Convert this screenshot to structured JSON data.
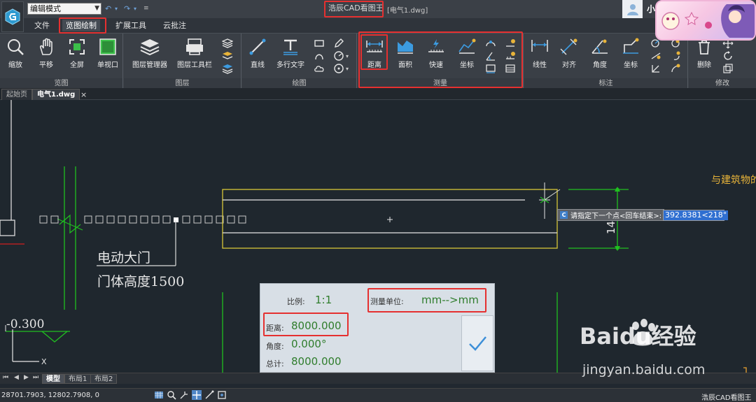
{
  "title_bar": {
    "mode": "编辑模式",
    "app_name": "浩辰CAD看图王",
    "file_name": "[电气1.dwg]",
    "user_name": "小可"
  },
  "menu": {
    "tabs": [
      "文件",
      "览图绘制",
      "扩展工具",
      "云批注"
    ],
    "active": "览图绘制"
  },
  "ribbon": {
    "view": {
      "label": "览图",
      "buttons": [
        "缩放",
        "平移",
        "全屏",
        "单视口"
      ]
    },
    "layer": {
      "label": "图层",
      "buttons": [
        "图层管理器",
        "图层工具栏"
      ]
    },
    "draw": {
      "label": "绘图",
      "buttons": [
        "直线",
        "多行文字"
      ]
    },
    "measure": {
      "label": "测量",
      "buttons": [
        "距离",
        "面积",
        "快速",
        "坐标"
      ]
    },
    "annotate": {
      "label": "标注",
      "buttons": [
        "线性",
        "对齐",
        "角度",
        "坐标"
      ]
    },
    "modify": {
      "label": "修改",
      "buttons": [
        "删除"
      ]
    }
  },
  "doc_tabs": {
    "start": "起始页",
    "file": "电气1.dwg",
    "close": "×"
  },
  "drawing": {
    "text_gate": "电动大门",
    "text_gate_height": "门体高度1500",
    "text_elevation": "-0.300",
    "text_building": "与建筑物的",
    "dim_vertical": "14",
    "axis_x": "X"
  },
  "command": {
    "icon": "C",
    "prompt": "请指定下一个点<回车结束>:",
    "input_value": "392.8381<218°"
  },
  "measure_panel": {
    "scale_label": "比例:",
    "scale_value": "1:1",
    "unit_label": "测量单位:",
    "unit_value": "mm-->mm",
    "distance_label": "距离:",
    "distance_value": "8000.000",
    "angle_label": "角度:",
    "angle_value": "0.000°",
    "total_label": "总计:",
    "total_value": "8000.000"
  },
  "layout_tabs": [
    "模型",
    "布局1",
    "布局2"
  ],
  "status_bar": {
    "coordinates": "28701.7903, 12802.7908, 0",
    "app_name": "浩辰CAD看图王"
  },
  "watermark": {
    "brand": "Baidu经验",
    "url": "jingyan.baidu.com"
  },
  "colors": {
    "canvas": "#1f272e",
    "highlight": "#e53030",
    "cad_yellow": "#d8c738",
    "cad_green": "#20c020",
    "measure_value": "#2f7d2c",
    "input_selected": "#2f6fd1"
  }
}
